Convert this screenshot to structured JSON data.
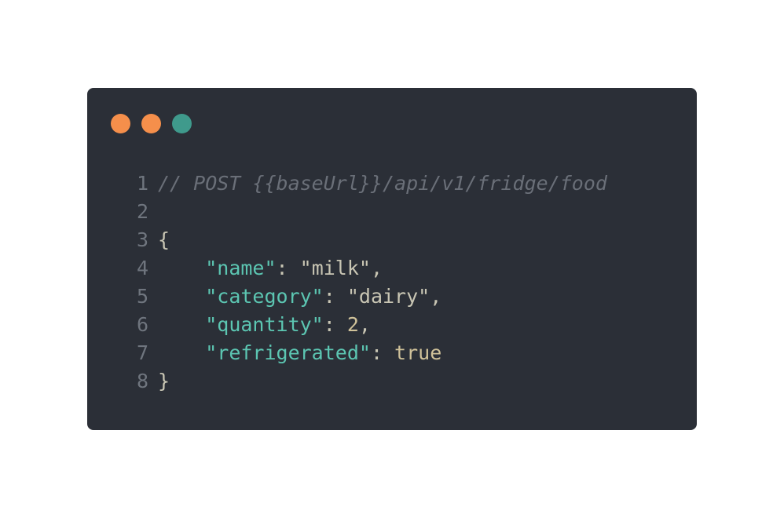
{
  "window": {
    "dots": [
      {
        "name": "close-dot",
        "color": "#f58f4b"
      },
      {
        "name": "minimize-dot",
        "color": "#f58f4b"
      },
      {
        "name": "maximize-dot",
        "color": "#3f9a8c"
      }
    ]
  },
  "code": {
    "lines": [
      {
        "num": "1",
        "comment": "// POST {{baseUrl}}/api/v1/fridge/food"
      },
      {
        "num": "2"
      },
      {
        "num": "3",
        "open": "{"
      },
      {
        "num": "4",
        "indent": "    ",
        "key": "\"name\"",
        "colon": ": ",
        "value": "\"milk\"",
        "comma": ","
      },
      {
        "num": "5",
        "indent": "    ",
        "key": "\"category\"",
        "colon": ": ",
        "value": "\"dairy\"",
        "comma": ","
      },
      {
        "num": "6",
        "indent": "    ",
        "key": "\"quantity\"",
        "colon": ": ",
        "value": "2",
        "comma": ","
      },
      {
        "num": "7",
        "indent": "    ",
        "key": "\"refrigerated\"",
        "colon": ": ",
        "value": "true",
        "comma": ""
      },
      {
        "num": "8",
        "close": "}"
      }
    ]
  }
}
